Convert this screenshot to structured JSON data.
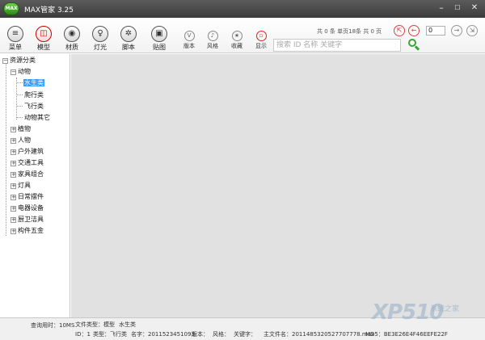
{
  "window": {
    "title": "MAX管家 3.25",
    "logo_text": "MAX"
  },
  "toolbar": {
    "big_tools": [
      {
        "label": "菜单",
        "icon": "menu-icon",
        "glyph": "≡"
      },
      {
        "label": "模型",
        "icon": "cube-icon",
        "glyph": "◫"
      },
      {
        "label": "材质",
        "icon": "material-ball-icon",
        "glyph": "◉"
      },
      {
        "label": "灯光",
        "icon": "bulb-icon",
        "glyph": "♀"
      },
      {
        "label": "脚本",
        "icon": "gear-icon",
        "glyph": "✲"
      },
      {
        "label": "贴图",
        "icon": "image-icon",
        "glyph": "▣"
      }
    ],
    "small_tools": [
      {
        "label": "版本",
        "icon": "version-icon",
        "glyph": "V"
      },
      {
        "label": "风格",
        "icon": "style-icon",
        "glyph": "♪"
      },
      {
        "label": "收藏",
        "icon": "star-icon",
        "glyph": "★"
      },
      {
        "label": "显示",
        "icon": "display-icon",
        "glyph": "▫"
      }
    ],
    "search_placeholder": "搜索   ID   名称   关键字",
    "pager_info": "共 0 条  单页18条  共 0 页",
    "page_value": "0"
  },
  "tree": {
    "root": "资源分类",
    "categories": [
      {
        "label": "动物",
        "children": [
          "水生类",
          "爬行类",
          "飞行类",
          "动物其它"
        ]
      },
      {
        "label": "植物"
      },
      {
        "label": "人物"
      },
      {
        "label": "户外建筑"
      },
      {
        "label": "交通工具"
      },
      {
        "label": "家具组合"
      },
      {
        "label": "灯具"
      },
      {
        "label": "日常摆件"
      },
      {
        "label": "电器设备"
      },
      {
        "label": "厨卫洁具"
      },
      {
        "label": "构件五金"
      }
    ],
    "selected": "水生类"
  },
  "status": {
    "query_time": "查询用时：10MS",
    "file_type": "文件类型：模型",
    "file_category": "水生类",
    "id": "ID：1",
    "type": "类型：飞行类",
    "name": "名字：2011523451093",
    "version": "版本：",
    "style": "风格：",
    "keywords": "关键字：",
    "main_file": "主文件名：2011485320527707778.max",
    "md5": "MD5：BE3E26E4F46EEFE22F"
  },
  "watermark": {
    "text": "XP510",
    "sub": "系统之家"
  }
}
